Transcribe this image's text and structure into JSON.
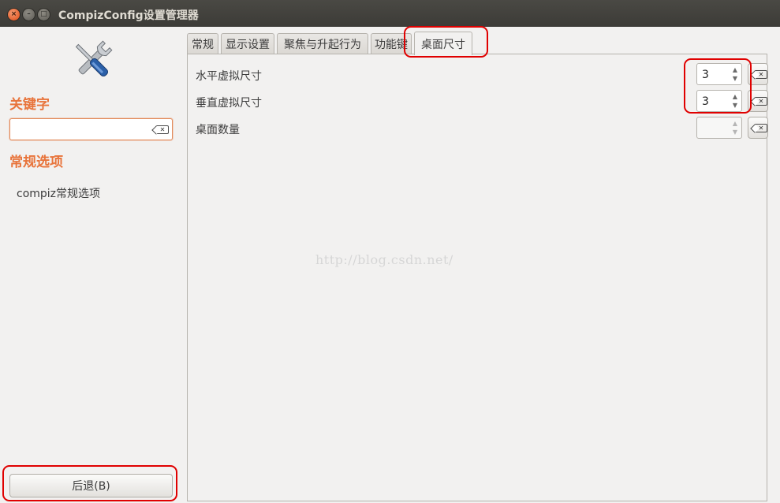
{
  "window": {
    "title": "CompizConfig设置管理器",
    "controls": {
      "close": "×",
      "minimize": "–",
      "maximize": "□"
    }
  },
  "sidebar": {
    "logo_icon": "tools-icon",
    "keyword_heading": "关键字",
    "search": {
      "value": "",
      "placeholder": ""
    },
    "category_heading": "常规选项",
    "categories": [
      "compiz常规选项"
    ],
    "back_button": "后退(B)"
  },
  "tabs": [
    {
      "label": "常规",
      "active": false
    },
    {
      "label": "显示设置",
      "active": false
    },
    {
      "label": "聚焦与升起行为",
      "active": false
    },
    {
      "label": "功能键",
      "active": false
    },
    {
      "label": "桌面尺寸",
      "active": true
    }
  ],
  "options": [
    {
      "label": "水平虚拟尺寸",
      "value": "3",
      "enabled": true
    },
    {
      "label": "垂直虚拟尺寸",
      "value": "3",
      "enabled": true
    },
    {
      "label": "桌面数量",
      "value": "",
      "enabled": false
    }
  ],
  "spin_arrows": {
    "up": "▲",
    "down": "▼"
  },
  "watermark": "http://blog.csdn.net/",
  "colors": {
    "accent_orange": "#e8743b",
    "highlight_red": "#e00000",
    "titlebar": "#3c3b37",
    "window_bg": "#f2f1f0"
  }
}
